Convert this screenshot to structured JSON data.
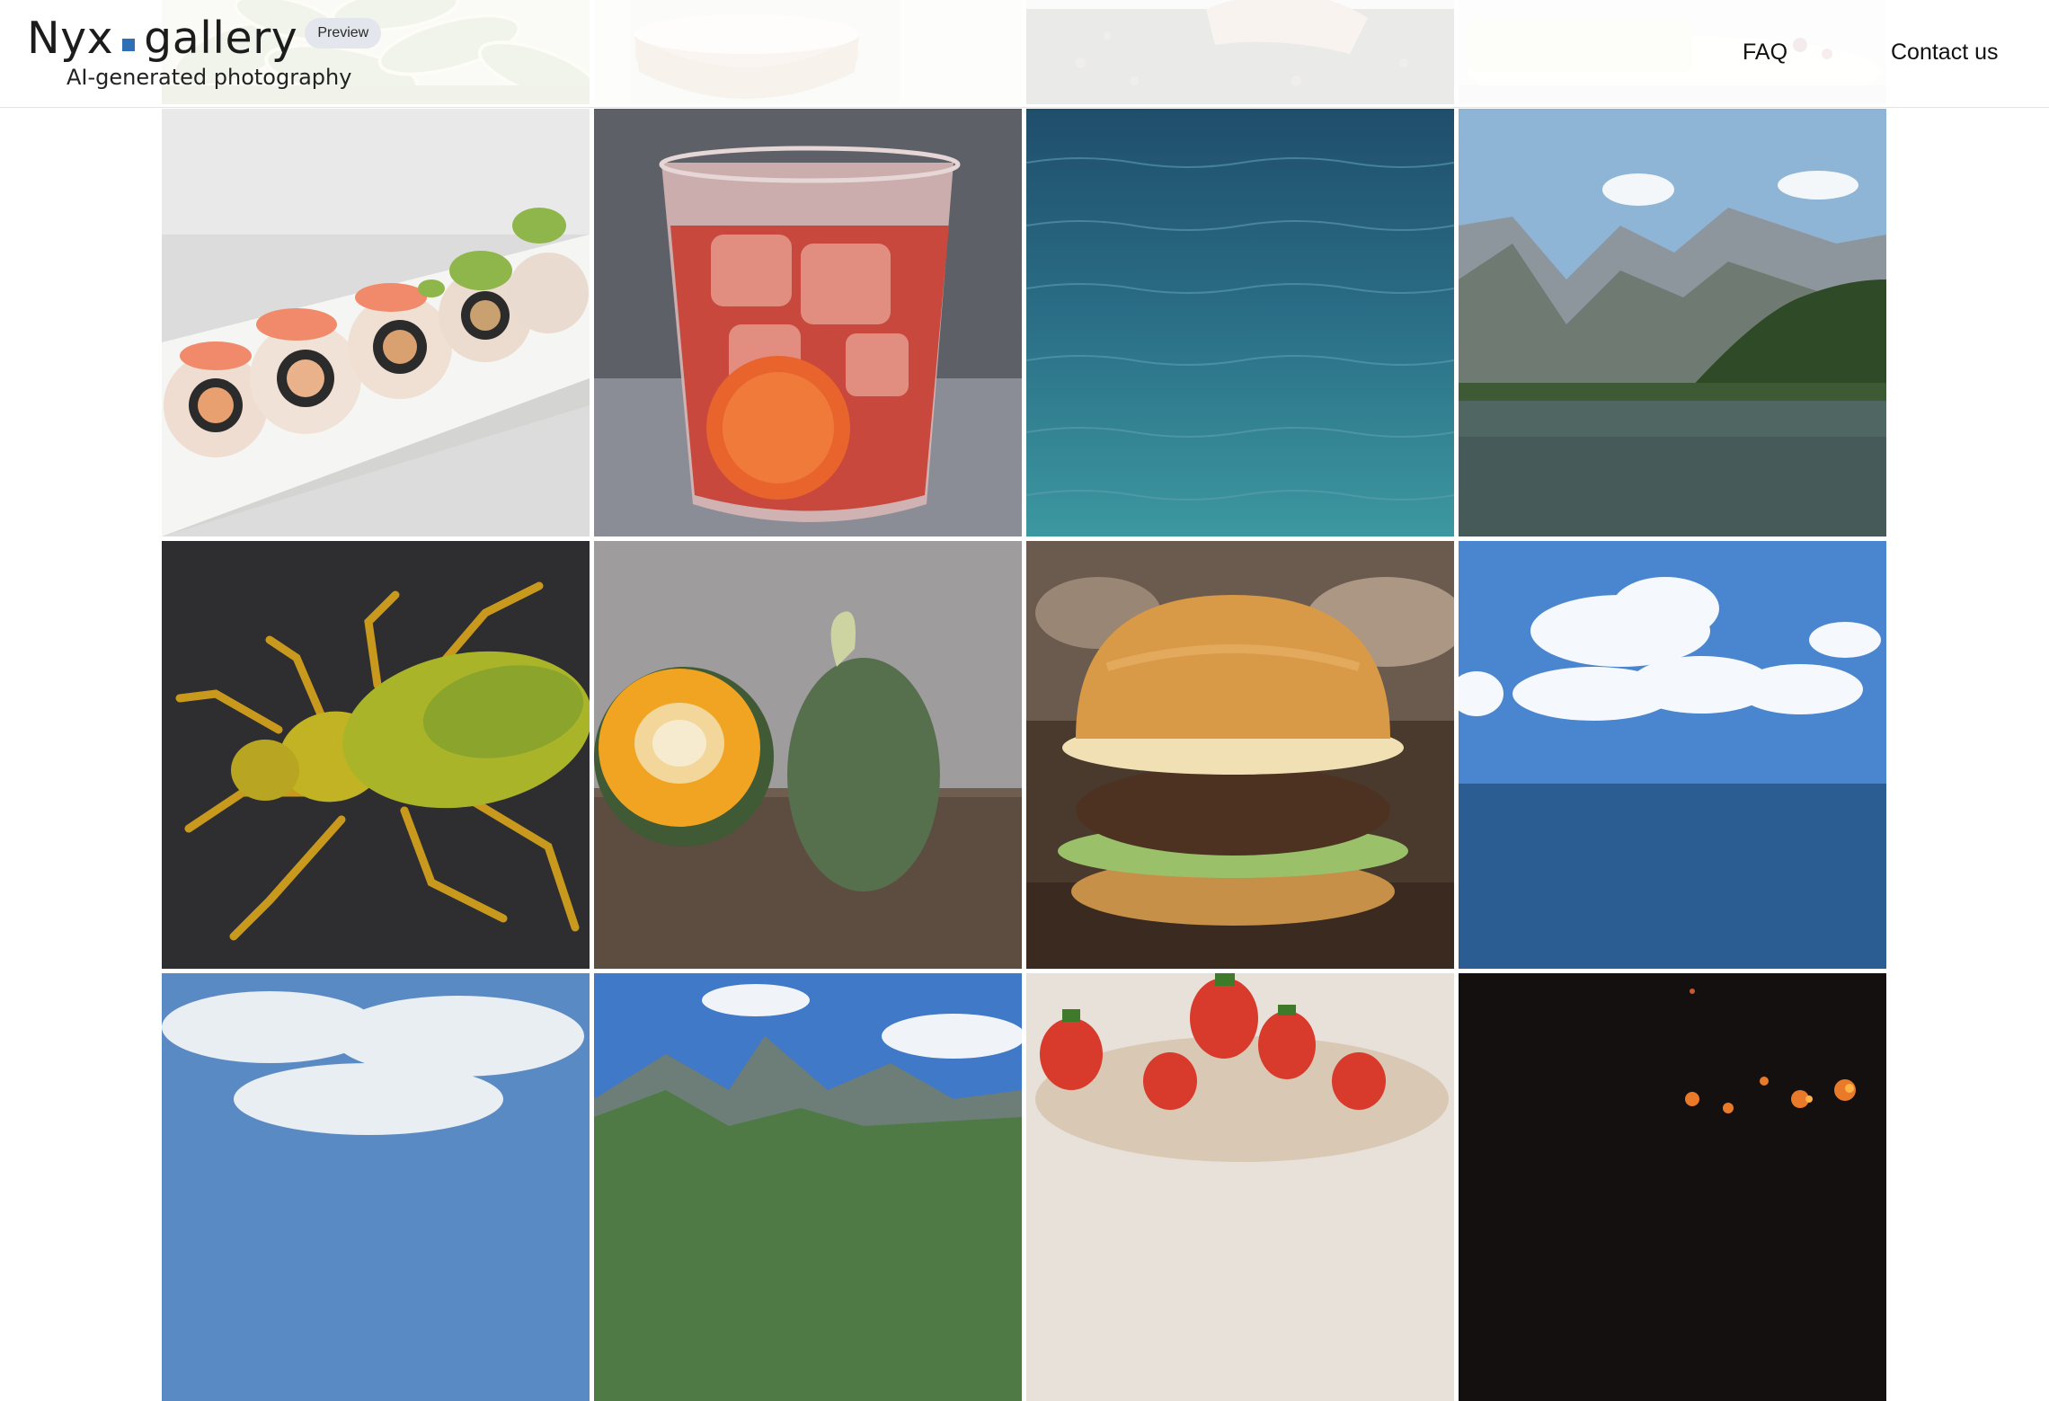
{
  "header": {
    "logo_part1": "Nyx",
    "logo_part2": "gallery",
    "badge": "Preview",
    "tagline": "AI-generated photography",
    "nav": {
      "faq": "FAQ",
      "contact": "Contact us"
    }
  },
  "colors": {
    "logo_dot": "#2e6fb6",
    "badge_bg": "#e3e6ec"
  },
  "gallery": [
    {
      "subject": "green leaves"
    },
    {
      "subject": "glass drink"
    },
    {
      "subject": "dark rocks"
    },
    {
      "subject": "cake on plate"
    },
    {
      "subject": "sushi rolls"
    },
    {
      "subject": "iced red drink"
    },
    {
      "subject": "ocean water"
    },
    {
      "subject": "mountain lake"
    },
    {
      "subject": "green beetle"
    },
    {
      "subject": "squash"
    },
    {
      "subject": "burger"
    },
    {
      "subject": "sky over sea"
    },
    {
      "subject": "cloudy sky"
    },
    {
      "subject": "mountain peaks"
    },
    {
      "subject": "strawberries"
    },
    {
      "subject": "fire at night"
    }
  ]
}
